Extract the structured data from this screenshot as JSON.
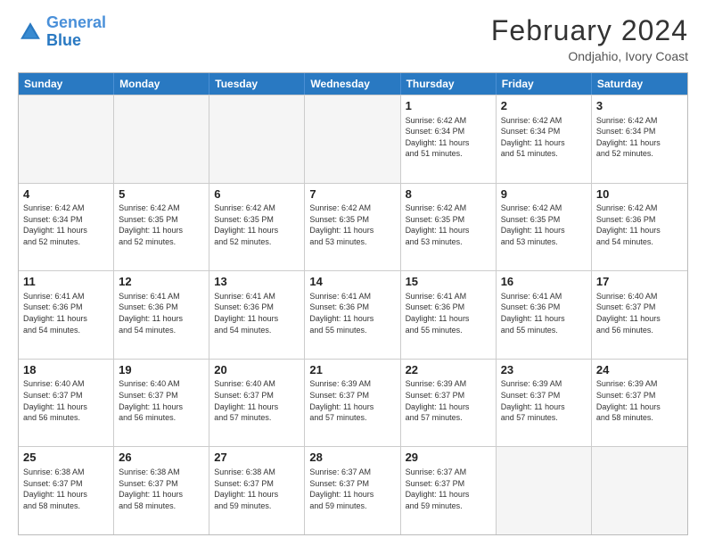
{
  "logo": {
    "line1": "General",
    "line2": "Blue"
  },
  "title": "February 2024",
  "subtitle": "Ondjahio, Ivory Coast",
  "days": [
    "Sunday",
    "Monday",
    "Tuesday",
    "Wednesday",
    "Thursday",
    "Friday",
    "Saturday"
  ],
  "rows": [
    [
      {
        "num": "",
        "info": ""
      },
      {
        "num": "",
        "info": ""
      },
      {
        "num": "",
        "info": ""
      },
      {
        "num": "",
        "info": ""
      },
      {
        "num": "1",
        "info": "Sunrise: 6:42 AM\nSunset: 6:34 PM\nDaylight: 11 hours\nand 51 minutes."
      },
      {
        "num": "2",
        "info": "Sunrise: 6:42 AM\nSunset: 6:34 PM\nDaylight: 11 hours\nand 51 minutes."
      },
      {
        "num": "3",
        "info": "Sunrise: 6:42 AM\nSunset: 6:34 PM\nDaylight: 11 hours\nand 52 minutes."
      }
    ],
    [
      {
        "num": "4",
        "info": "Sunrise: 6:42 AM\nSunset: 6:34 PM\nDaylight: 11 hours\nand 52 minutes."
      },
      {
        "num": "5",
        "info": "Sunrise: 6:42 AM\nSunset: 6:35 PM\nDaylight: 11 hours\nand 52 minutes."
      },
      {
        "num": "6",
        "info": "Sunrise: 6:42 AM\nSunset: 6:35 PM\nDaylight: 11 hours\nand 52 minutes."
      },
      {
        "num": "7",
        "info": "Sunrise: 6:42 AM\nSunset: 6:35 PM\nDaylight: 11 hours\nand 53 minutes."
      },
      {
        "num": "8",
        "info": "Sunrise: 6:42 AM\nSunset: 6:35 PM\nDaylight: 11 hours\nand 53 minutes."
      },
      {
        "num": "9",
        "info": "Sunrise: 6:42 AM\nSunset: 6:35 PM\nDaylight: 11 hours\nand 53 minutes."
      },
      {
        "num": "10",
        "info": "Sunrise: 6:42 AM\nSunset: 6:36 PM\nDaylight: 11 hours\nand 54 minutes."
      }
    ],
    [
      {
        "num": "11",
        "info": "Sunrise: 6:41 AM\nSunset: 6:36 PM\nDaylight: 11 hours\nand 54 minutes."
      },
      {
        "num": "12",
        "info": "Sunrise: 6:41 AM\nSunset: 6:36 PM\nDaylight: 11 hours\nand 54 minutes."
      },
      {
        "num": "13",
        "info": "Sunrise: 6:41 AM\nSunset: 6:36 PM\nDaylight: 11 hours\nand 54 minutes."
      },
      {
        "num": "14",
        "info": "Sunrise: 6:41 AM\nSunset: 6:36 PM\nDaylight: 11 hours\nand 55 minutes."
      },
      {
        "num": "15",
        "info": "Sunrise: 6:41 AM\nSunset: 6:36 PM\nDaylight: 11 hours\nand 55 minutes."
      },
      {
        "num": "16",
        "info": "Sunrise: 6:41 AM\nSunset: 6:36 PM\nDaylight: 11 hours\nand 55 minutes."
      },
      {
        "num": "17",
        "info": "Sunrise: 6:40 AM\nSunset: 6:37 PM\nDaylight: 11 hours\nand 56 minutes."
      }
    ],
    [
      {
        "num": "18",
        "info": "Sunrise: 6:40 AM\nSunset: 6:37 PM\nDaylight: 11 hours\nand 56 minutes."
      },
      {
        "num": "19",
        "info": "Sunrise: 6:40 AM\nSunset: 6:37 PM\nDaylight: 11 hours\nand 56 minutes."
      },
      {
        "num": "20",
        "info": "Sunrise: 6:40 AM\nSunset: 6:37 PM\nDaylight: 11 hours\nand 57 minutes."
      },
      {
        "num": "21",
        "info": "Sunrise: 6:39 AM\nSunset: 6:37 PM\nDaylight: 11 hours\nand 57 minutes."
      },
      {
        "num": "22",
        "info": "Sunrise: 6:39 AM\nSunset: 6:37 PM\nDaylight: 11 hours\nand 57 minutes."
      },
      {
        "num": "23",
        "info": "Sunrise: 6:39 AM\nSunset: 6:37 PM\nDaylight: 11 hours\nand 57 minutes."
      },
      {
        "num": "24",
        "info": "Sunrise: 6:39 AM\nSunset: 6:37 PM\nDaylight: 11 hours\nand 58 minutes."
      }
    ],
    [
      {
        "num": "25",
        "info": "Sunrise: 6:38 AM\nSunset: 6:37 PM\nDaylight: 11 hours\nand 58 minutes."
      },
      {
        "num": "26",
        "info": "Sunrise: 6:38 AM\nSunset: 6:37 PM\nDaylight: 11 hours\nand 58 minutes."
      },
      {
        "num": "27",
        "info": "Sunrise: 6:38 AM\nSunset: 6:37 PM\nDaylight: 11 hours\nand 59 minutes."
      },
      {
        "num": "28",
        "info": "Sunrise: 6:37 AM\nSunset: 6:37 PM\nDaylight: 11 hours\nand 59 minutes."
      },
      {
        "num": "29",
        "info": "Sunrise: 6:37 AM\nSunset: 6:37 PM\nDaylight: 11 hours\nand 59 minutes."
      },
      {
        "num": "",
        "info": ""
      },
      {
        "num": "",
        "info": ""
      }
    ]
  ]
}
